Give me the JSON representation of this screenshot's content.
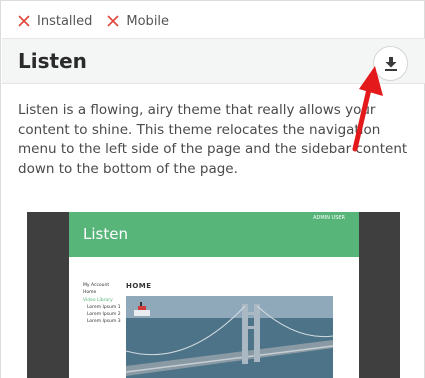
{
  "tags": [
    {
      "label": "Installed",
      "icon": "close-icon"
    },
    {
      "label": "Mobile",
      "icon": "close-icon"
    }
  ],
  "theme": {
    "title": "Listen",
    "download_icon": "download-icon",
    "description": "Listen is a flowing, airy theme that really allows your content to shine. This theme relocates the navigation menu to the left side of the page and the sidebar content down to the bottom of the page."
  },
  "preview": {
    "site_title": "Listen",
    "admin_label": "ADMIN USER",
    "nav_items": [
      "My Account",
      "Home",
      "Video Library",
      "Lorem Ipsum 1",
      "Lorem Ipsum 2",
      "Lorem Ipsum 3"
    ],
    "page_heading": "HOME"
  },
  "colors": {
    "accent_green": "#57b57a",
    "tag_x_red": "#e0483c",
    "arrow_red": "#e3191c"
  }
}
